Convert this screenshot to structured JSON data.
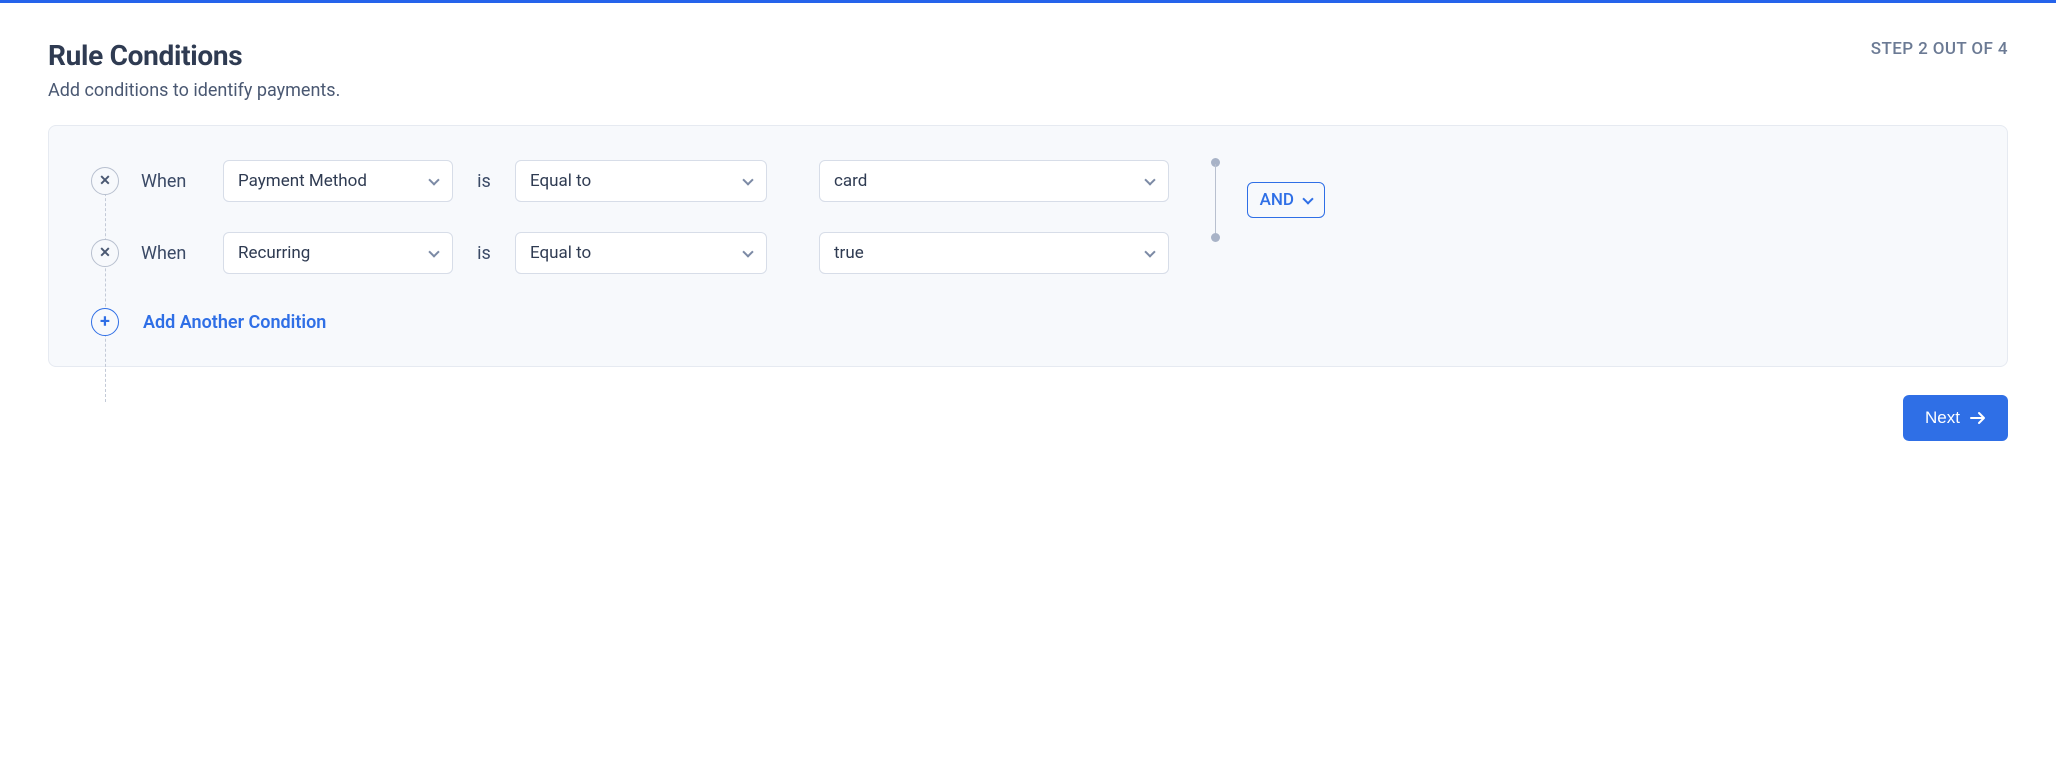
{
  "header": {
    "title": "Rule Conditions",
    "step_label": "STEP 2 OUT OF 4",
    "subtitle": "Add conditions to identify payments."
  },
  "labels": {
    "when": "When",
    "is": "is"
  },
  "conditions": [
    {
      "field": "Payment Method",
      "operator": "Equal to",
      "value": "card"
    },
    {
      "field": "Recurring",
      "operator": "Equal to",
      "value": "true"
    }
  ],
  "combinator": {
    "label": "AND"
  },
  "add_condition": {
    "label": "Add Another Condition"
  },
  "footer": {
    "next_label": "Next"
  }
}
